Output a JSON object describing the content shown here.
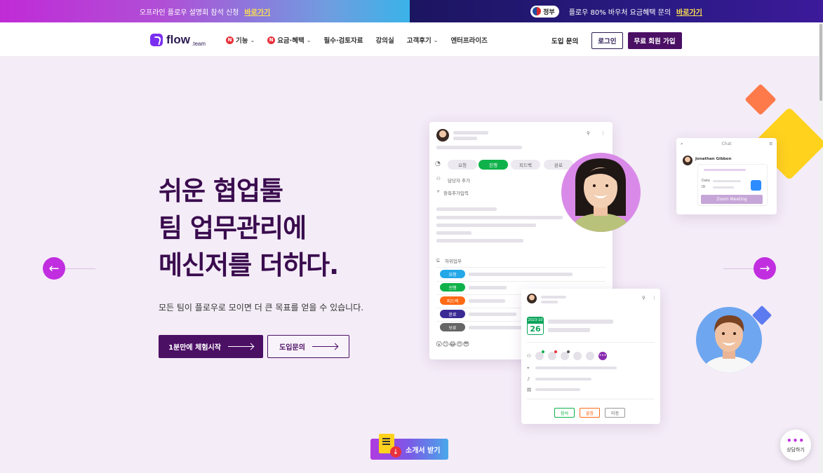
{
  "banner": {
    "left_text": "오프라인 플로우 설명회 참석 신청",
    "left_link": "바로가기",
    "gov_badge": "정부",
    "right_text": "플로우 80% 바우처 요금혜택 문의",
    "right_link": "바로가기"
  },
  "nav": {
    "logo": "flow",
    "logo_sub": ".team",
    "new_badge": "N",
    "menu": [
      "기능",
      "요금·혜택",
      "필수·검토자료",
      "강의실",
      "고객후기",
      "엔터프라이즈"
    ],
    "inquiry": "도입 문의",
    "login": "로그인",
    "signup": "무료 회원 가입"
  },
  "hero": {
    "headline_1": "쉬운 협업툴",
    "headline_2": "팀 업무관리에",
    "headline_3": "메신저를 더하다.",
    "subline": "모든 팀이 플로우로 모이면 더 큰 목표를 얻을 수 있습니다.",
    "cta_primary": "1분만에 체험시작",
    "cta_secondary": "도입문의"
  },
  "illustration": {
    "status_pills": [
      "요청",
      "진행",
      "피드백",
      "완료"
    ],
    "assignee": "담당자 추가",
    "add_item": "항목추가입력",
    "subtask_label": "하위업무",
    "subtask_tags": [
      "요청",
      "진행",
      "피드백",
      "완료",
      "보류"
    ],
    "emojis": "😮😊😂😍😎",
    "chat_title": "Chat",
    "chat_user": "Jonathan Gibbon",
    "chat_date": "Date",
    "chat_id": "ID",
    "chat_button": "Zoom Meeting",
    "event_month": "2023-10",
    "event_day": "26",
    "event_buttons": [
      "참석",
      "불참",
      "미정"
    ]
  },
  "download": "소개서 받기",
  "consult": "상담하기",
  "colors": {
    "brand": "#4b0f64",
    "accent": "#c12ee0",
    "background": "#f4ecf7"
  }
}
